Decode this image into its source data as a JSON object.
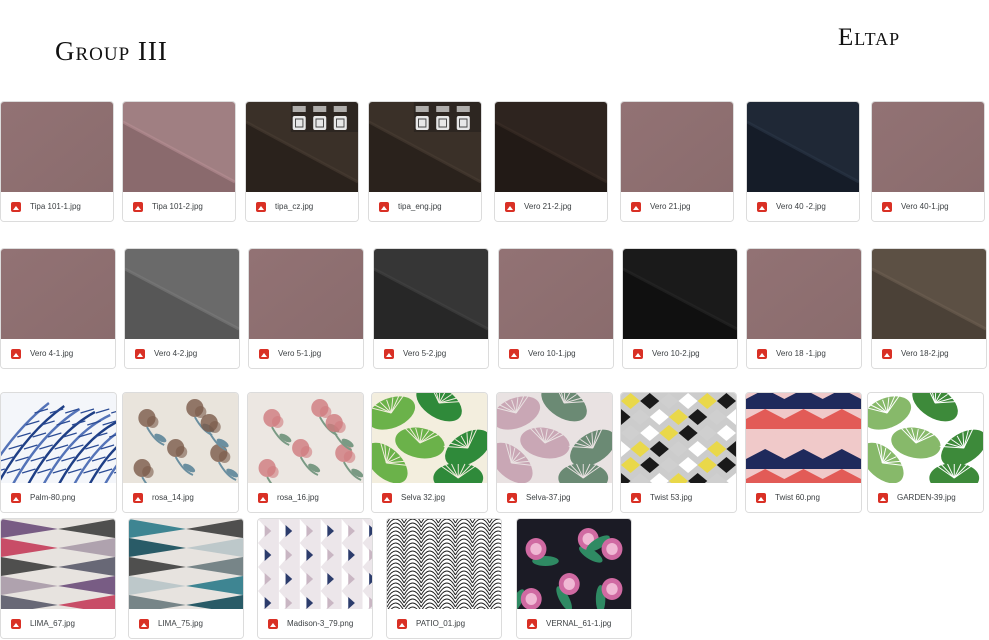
{
  "headings": {
    "left": "Group III",
    "right": "Eltap"
  },
  "files": [
    {
      "name": "Tipa 101-1.jpg"
    },
    {
      "name": "Tipa 101-2.jpg"
    },
    {
      "name": "tipa_cz.jpg"
    },
    {
      "name": "tipa_eng.jpg"
    },
    {
      "name": "Vero 21-2.jpg"
    },
    {
      "name": "Vero 21.jpg"
    },
    {
      "name": "Vero 40 -2.jpg"
    },
    {
      "name": "Vero 40-1.jpg"
    },
    {
      "name": "Vero 4-1.jpg"
    },
    {
      "name": "Vero 4-2.jpg"
    },
    {
      "name": "Vero 5-1.jpg"
    },
    {
      "name": "Vero 5-2.jpg"
    },
    {
      "name": "Vero 10-1.jpg"
    },
    {
      "name": "Vero 10-2.jpg"
    },
    {
      "name": "Vero 18 -1.jpg"
    },
    {
      "name": "Vero 18-2.jpg"
    },
    {
      "name": "Palm-80.png"
    },
    {
      "name": "rosa_14.jpg"
    },
    {
      "name": "rosa_16.jpg"
    },
    {
      "name": "Selva 32.jpg"
    },
    {
      "name": "Selva-37.jpg"
    },
    {
      "name": "Twist 53.jpg"
    },
    {
      "name": "Twist 60.png"
    },
    {
      "name": "GARDEN-39.jpg"
    },
    {
      "name": "LIMA_67.jpg"
    },
    {
      "name": "LIMA_75.jpg"
    },
    {
      "name": "Madison-3_79.png"
    },
    {
      "name": "PATIO_01.jpg"
    },
    {
      "name": "VERNAL_61-1.jpg"
    }
  ],
  "file_icon": "image-file-icon",
  "colors": {
    "file_icon": "#d93025",
    "caption_text": "#3c4043",
    "tile_border": "#dcdcdc"
  }
}
